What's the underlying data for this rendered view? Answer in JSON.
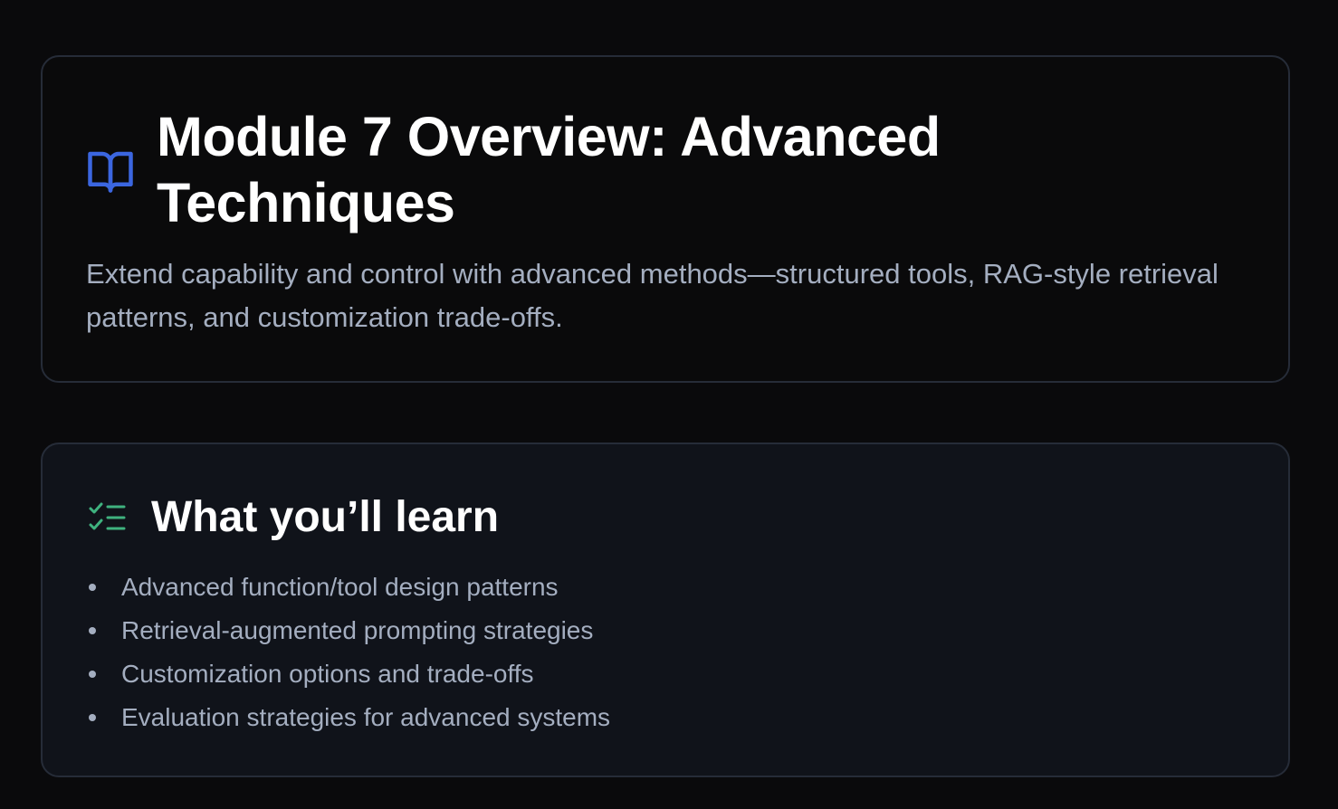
{
  "overview": {
    "title": "Module 7 Overview: Advanced Techniques",
    "description": "Extend capability and control with advanced methods—structured tools, RAG-style retrieval patterns, and customization trade-offs.",
    "icon": "book-open-icon",
    "icon_color": "#3b66e0"
  },
  "learn": {
    "title": "What you’ll learn",
    "icon": "list-checks-icon",
    "icon_color": "#3fb27f",
    "items": [
      "Advanced function/tool design patterns",
      "Retrieval-augmented prompting strategies",
      "Customization options and trade-offs",
      "Evaluation strategies for advanced systems"
    ]
  },
  "colors": {
    "background": "#0a0a0c",
    "card_border": "#262c38",
    "learn_card_bg": "#10131a",
    "heading": "#ffffff",
    "body_text": "#a4aec0"
  }
}
